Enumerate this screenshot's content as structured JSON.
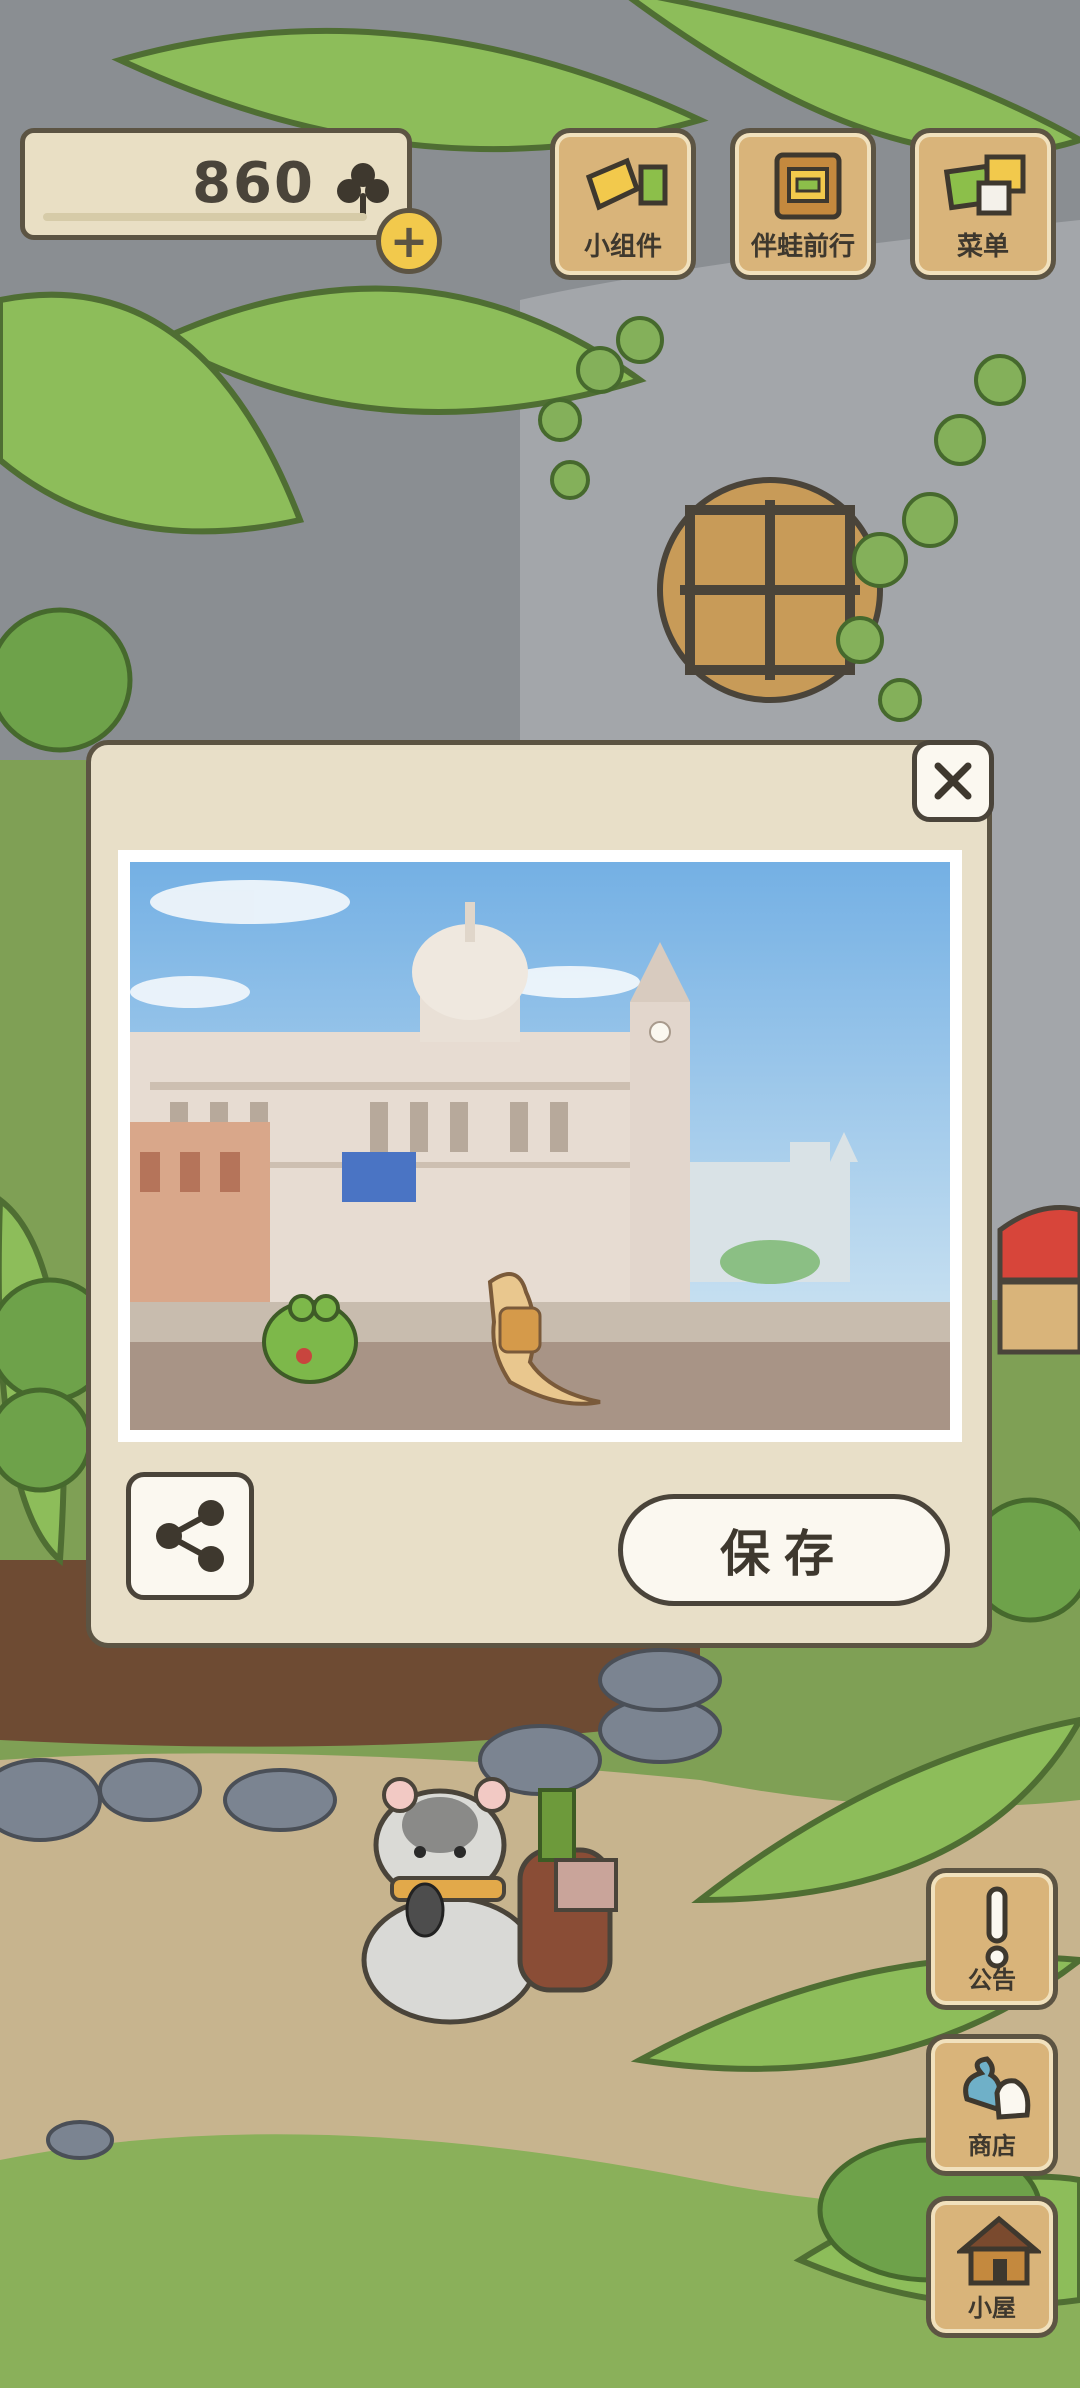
{
  "hud": {
    "clover_count": "860",
    "plus_label": "+"
  },
  "top_menu": [
    {
      "label": "小组件",
      "icon": "widget-icon"
    },
    {
      "label": "伴蛙前行",
      "icon": "journal-icon"
    },
    {
      "label": "菜单",
      "icon": "menu-cards-icon"
    }
  ],
  "side_menu": [
    {
      "label": "公告",
      "icon": "exclamation-icon"
    },
    {
      "label": "商店",
      "icon": "shop-bags-icon"
    },
    {
      "label": "小屋",
      "icon": "house-icon"
    }
  ],
  "photo_dialog": {
    "close_symbol": "✕",
    "save_label": "保存",
    "share_icon": "share-icon",
    "photo_subject": "frog-and-lizard-at-waterfront"
  },
  "colors": {
    "panel": "#e8dfc8",
    "outline": "#5c5443",
    "button_wood": "#d9b47a",
    "foliage": "#7aa64a"
  }
}
